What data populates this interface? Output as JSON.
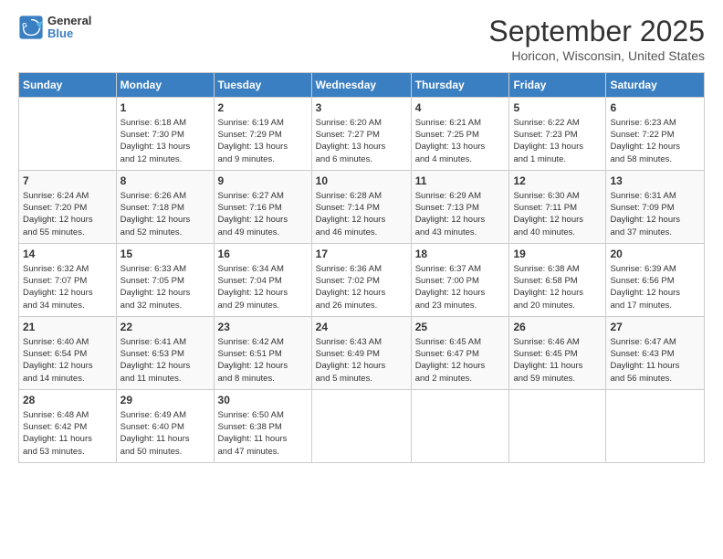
{
  "header": {
    "logo_general": "General",
    "logo_blue": "Blue",
    "month_title": "September 2025",
    "location": "Horicon, Wisconsin, United States"
  },
  "days_of_week": [
    "Sunday",
    "Monday",
    "Tuesday",
    "Wednesday",
    "Thursday",
    "Friday",
    "Saturday"
  ],
  "weeks": [
    [
      {
        "day": "",
        "content": ""
      },
      {
        "day": "1",
        "content": "Sunrise: 6:18 AM\nSunset: 7:30 PM\nDaylight: 13 hours\nand 12 minutes."
      },
      {
        "day": "2",
        "content": "Sunrise: 6:19 AM\nSunset: 7:29 PM\nDaylight: 13 hours\nand 9 minutes."
      },
      {
        "day": "3",
        "content": "Sunrise: 6:20 AM\nSunset: 7:27 PM\nDaylight: 13 hours\nand 6 minutes."
      },
      {
        "day": "4",
        "content": "Sunrise: 6:21 AM\nSunset: 7:25 PM\nDaylight: 13 hours\nand 4 minutes."
      },
      {
        "day": "5",
        "content": "Sunrise: 6:22 AM\nSunset: 7:23 PM\nDaylight: 13 hours\nand 1 minute."
      },
      {
        "day": "6",
        "content": "Sunrise: 6:23 AM\nSunset: 7:22 PM\nDaylight: 12 hours\nand 58 minutes."
      }
    ],
    [
      {
        "day": "7",
        "content": "Sunrise: 6:24 AM\nSunset: 7:20 PM\nDaylight: 12 hours\nand 55 minutes."
      },
      {
        "day": "8",
        "content": "Sunrise: 6:26 AM\nSunset: 7:18 PM\nDaylight: 12 hours\nand 52 minutes."
      },
      {
        "day": "9",
        "content": "Sunrise: 6:27 AM\nSunset: 7:16 PM\nDaylight: 12 hours\nand 49 minutes."
      },
      {
        "day": "10",
        "content": "Sunrise: 6:28 AM\nSunset: 7:14 PM\nDaylight: 12 hours\nand 46 minutes."
      },
      {
        "day": "11",
        "content": "Sunrise: 6:29 AM\nSunset: 7:13 PM\nDaylight: 12 hours\nand 43 minutes."
      },
      {
        "day": "12",
        "content": "Sunrise: 6:30 AM\nSunset: 7:11 PM\nDaylight: 12 hours\nand 40 minutes."
      },
      {
        "day": "13",
        "content": "Sunrise: 6:31 AM\nSunset: 7:09 PM\nDaylight: 12 hours\nand 37 minutes."
      }
    ],
    [
      {
        "day": "14",
        "content": "Sunrise: 6:32 AM\nSunset: 7:07 PM\nDaylight: 12 hours\nand 34 minutes."
      },
      {
        "day": "15",
        "content": "Sunrise: 6:33 AM\nSunset: 7:05 PM\nDaylight: 12 hours\nand 32 minutes."
      },
      {
        "day": "16",
        "content": "Sunrise: 6:34 AM\nSunset: 7:04 PM\nDaylight: 12 hours\nand 29 minutes."
      },
      {
        "day": "17",
        "content": "Sunrise: 6:36 AM\nSunset: 7:02 PM\nDaylight: 12 hours\nand 26 minutes."
      },
      {
        "day": "18",
        "content": "Sunrise: 6:37 AM\nSunset: 7:00 PM\nDaylight: 12 hours\nand 23 minutes."
      },
      {
        "day": "19",
        "content": "Sunrise: 6:38 AM\nSunset: 6:58 PM\nDaylight: 12 hours\nand 20 minutes."
      },
      {
        "day": "20",
        "content": "Sunrise: 6:39 AM\nSunset: 6:56 PM\nDaylight: 12 hours\nand 17 minutes."
      }
    ],
    [
      {
        "day": "21",
        "content": "Sunrise: 6:40 AM\nSunset: 6:54 PM\nDaylight: 12 hours\nand 14 minutes."
      },
      {
        "day": "22",
        "content": "Sunrise: 6:41 AM\nSunset: 6:53 PM\nDaylight: 12 hours\nand 11 minutes."
      },
      {
        "day": "23",
        "content": "Sunrise: 6:42 AM\nSunset: 6:51 PM\nDaylight: 12 hours\nand 8 minutes."
      },
      {
        "day": "24",
        "content": "Sunrise: 6:43 AM\nSunset: 6:49 PM\nDaylight: 12 hours\nand 5 minutes."
      },
      {
        "day": "25",
        "content": "Sunrise: 6:45 AM\nSunset: 6:47 PM\nDaylight: 12 hours\nand 2 minutes."
      },
      {
        "day": "26",
        "content": "Sunrise: 6:46 AM\nSunset: 6:45 PM\nDaylight: 11 hours\nand 59 minutes."
      },
      {
        "day": "27",
        "content": "Sunrise: 6:47 AM\nSunset: 6:43 PM\nDaylight: 11 hours\nand 56 minutes."
      }
    ],
    [
      {
        "day": "28",
        "content": "Sunrise: 6:48 AM\nSunset: 6:42 PM\nDaylight: 11 hours\nand 53 minutes."
      },
      {
        "day": "29",
        "content": "Sunrise: 6:49 AM\nSunset: 6:40 PM\nDaylight: 11 hours\nand 50 minutes."
      },
      {
        "day": "30",
        "content": "Sunrise: 6:50 AM\nSunset: 6:38 PM\nDaylight: 11 hours\nand 47 minutes."
      },
      {
        "day": "",
        "content": ""
      },
      {
        "day": "",
        "content": ""
      },
      {
        "day": "",
        "content": ""
      },
      {
        "day": "",
        "content": ""
      }
    ]
  ]
}
